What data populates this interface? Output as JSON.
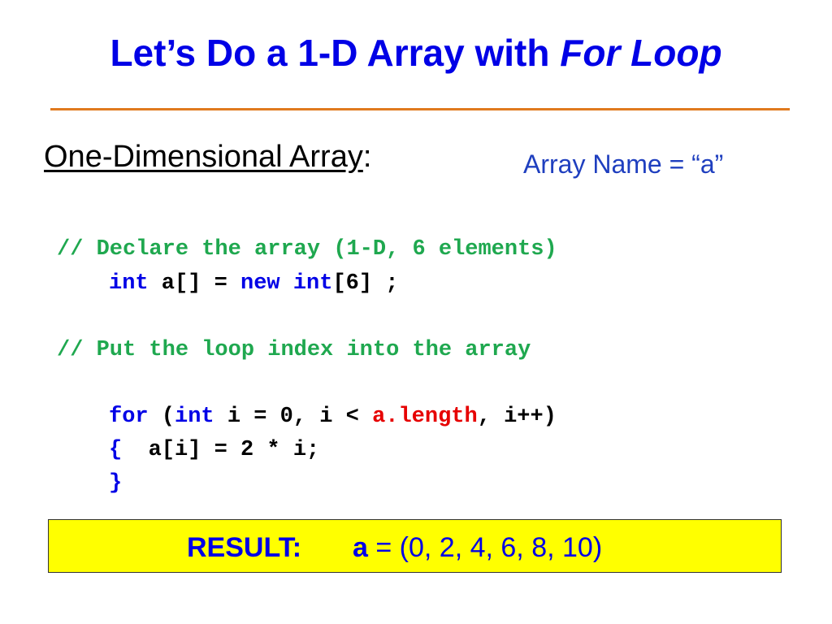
{
  "slide": {
    "title_main": "Let’s Do a 1-D Array with ",
    "title_em": "For Loop",
    "subheading": "One-Dimensional Array",
    "subheading_colon": ":",
    "array_name": "Array Name = “a”"
  },
  "code": {
    "comment1": "// Declare the array (1-D, 6 elements)",
    "kw_int": "int",
    "decl_a": " a[] = ",
    "kw_new": "new",
    "decl_sp": " ",
    "kw_int2": "int",
    "decl_tail": "[6] ;",
    "comment2": "// Put the loop index into the array",
    "kw_for": "for",
    "for_paren": " (",
    "kw_int3": "int",
    "for_mid": " i = 0, i < ",
    "for_length": "a.length",
    "for_end": ", i++)",
    "brace_open": "{",
    "body": "  a[i] = 2 * i;",
    "brace_close": "}"
  },
  "result": {
    "label": "RESULT:",
    "var": "a",
    "value": " = (0, 2, 4, 6, 8, 10)"
  },
  "colors": {
    "title": "#0000e6",
    "rule": "#e07a1f",
    "comment": "#1fa84f",
    "keyword": "#0000e6",
    "highlight": "#e60000",
    "result_bg": "#ffff00"
  }
}
